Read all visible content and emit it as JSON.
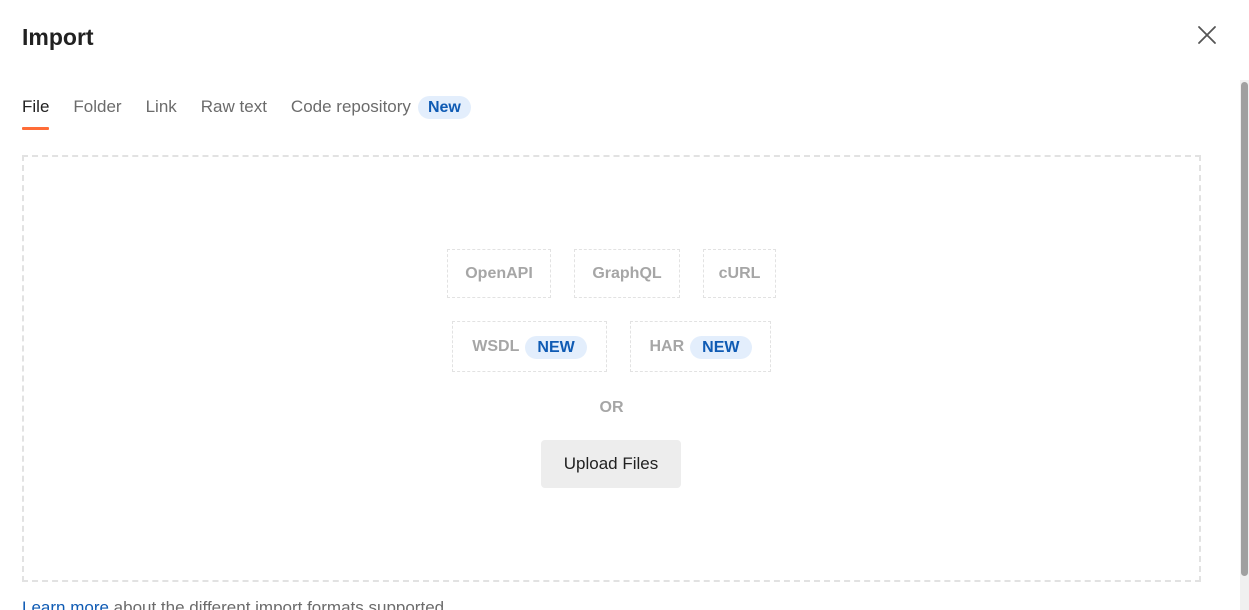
{
  "dialog": {
    "title": "Import",
    "close_icon": "close-icon"
  },
  "tabs": [
    {
      "label": "File",
      "active": true
    },
    {
      "label": "Folder",
      "active": false
    },
    {
      "label": "Link",
      "active": false
    },
    {
      "label": "Raw text",
      "active": false
    },
    {
      "label": "Code repository",
      "active": false,
      "badge": "New"
    }
  ],
  "dropzone": {
    "formats_row1": [
      {
        "label": "OpenAPI"
      },
      {
        "label": "GraphQL"
      },
      {
        "label": "cURL"
      }
    ],
    "formats_row2": [
      {
        "label": "WSDL",
        "badge": "NEW"
      },
      {
        "label": "HAR",
        "badge": "NEW"
      }
    ],
    "or_label": "OR",
    "upload_label": "Upload Files"
  },
  "footer": {
    "link_text": "Learn more",
    "text": "about the different import formats supported."
  },
  "colors": {
    "accent": "#ff6c37",
    "badge_bg": "#e3eefc",
    "badge_text": "#0f5bb4"
  }
}
